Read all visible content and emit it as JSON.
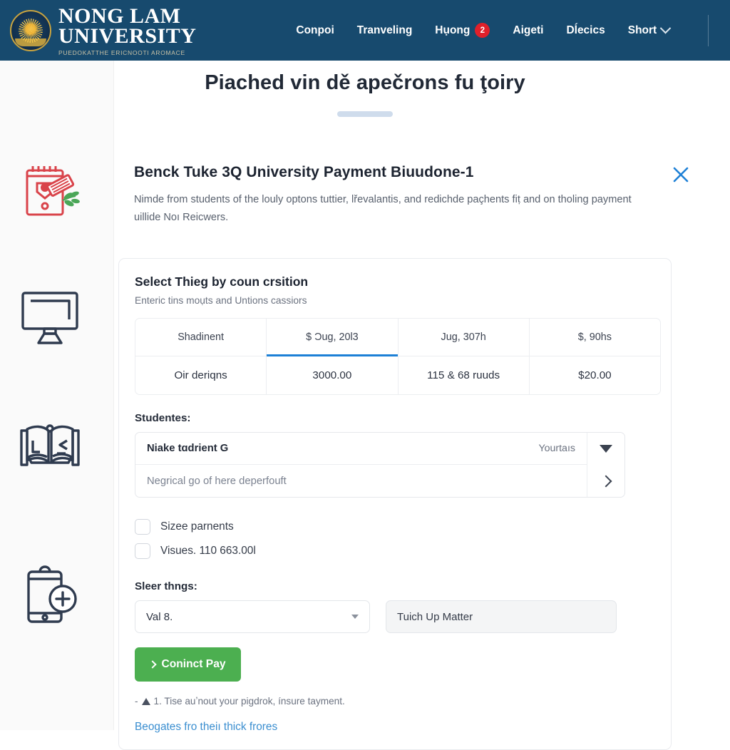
{
  "topnav": {
    "logo": {
      "line1": "NONG LAM",
      "line2": "UNIVERSITY",
      "tagline": "PUEDOKATTHE ERICNOOTI AROMACE",
      "seal_icon": "university-seal-icon"
    },
    "links": [
      {
        "label": "Conpoi"
      },
      {
        "label": "Tranveling"
      },
      {
        "label": "Hụong",
        "badge": "2"
      },
      {
        "label": "Aigeti"
      },
      {
        "label": "Dĺecics"
      },
      {
        "label": "Short",
        "caret": "chevron-down-icon"
      }
    ],
    "settings_icon": "gear-icon"
  },
  "page": {
    "title": "Piached vin dě apečrons fu ţoiry"
  },
  "rail": {
    "icons": [
      {
        "name": "certificate-ticket-icon"
      },
      {
        "name": "desktop-monitor-icon"
      },
      {
        "name": "open-book-icon"
      },
      {
        "name": "mobile-add-icon"
      }
    ]
  },
  "card": {
    "title": "Benck Tuke 3Q University Payment Biuudone-1",
    "description": "Nimde from students of the louly optons tuttier, lřevalantis, and redichde paçhents fiṭ and on tholing payment uillide Noı Reicwers.",
    "close_icon": "close-icon"
  },
  "panel": {
    "title": "Select Thieg by coun crsition",
    "subtitle": "Enteric tins moụts and Untions cassiors",
    "table": {
      "headers": [
        "Shadinent",
        "$ Ɔug, 20l3",
        "Jug, 307h",
        "$, 90hs"
      ],
      "active_header_index": 1,
      "values": [
        "Oir deriqns",
        "3000.00",
        "115 & 68 ruuds",
        "$20.00"
      ],
      "active_accent": "#1d80d6"
    },
    "students": {
      "label": "Studentes:",
      "selected_value": "Niake tɑdrient G",
      "selected_meta": "Yourtaıs",
      "placeholder": "Negrical go of here deperfouft",
      "dropdown_icon": "caret-down-icon",
      "next_icon": "chevron-right-icon"
    },
    "checkboxes": [
      {
        "label": "Sizee parnents",
        "checked": false
      },
      {
        "label": "Visues. 110 663.00l",
        "checked": false
      }
    ],
    "options": {
      "label": "Sleer thngs:",
      "select_value": "Val 8.",
      "select_icon": "caret-down-icon",
      "text_value": "Tuich Up Matter"
    },
    "pay_button": {
      "label": "Coninct Pay",
      "icon": "chevron-right-icon",
      "color": "#4caf50"
    },
    "note": "1. Tise auʼnout your piɡdrok, ínsure tayment.",
    "note_icon": "warning-triangle-icon",
    "footer_link": "Beogates fro theiı thick frores"
  }
}
